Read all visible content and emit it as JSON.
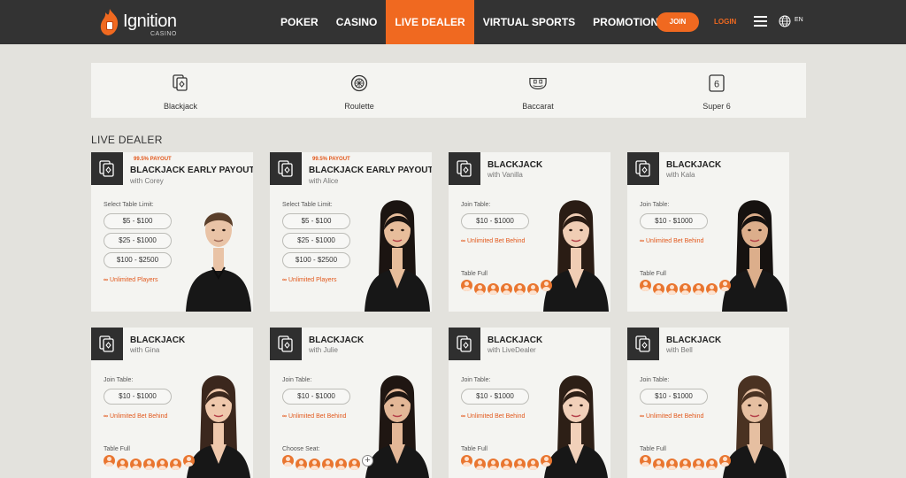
{
  "brand": {
    "name": "Ignition",
    "sub": "CASINO"
  },
  "nav": [
    {
      "label": "POKER",
      "active": false
    },
    {
      "label": "CASINO",
      "active": false
    },
    {
      "label": "LIVE DEALER",
      "active": true
    },
    {
      "label": "VIRTUAL SPORTS",
      "active": false
    },
    {
      "label": "PROMOTIONS",
      "active": false
    }
  ],
  "header": {
    "join": "JOIN",
    "login": "LOGIN",
    "lang": "EN"
  },
  "categories": [
    {
      "label": "Blackjack",
      "icon": "cards-icon"
    },
    {
      "label": "Roulette",
      "icon": "roulette-wheel-icon"
    },
    {
      "label": "Baccarat",
      "icon": "baccarat-table-icon"
    },
    {
      "label": "Super 6",
      "icon": "super-six-icon"
    }
  ],
  "section_title": "LIVE DEALER",
  "cards": [
    {
      "badge": "99.5% PAYOUT",
      "title": "BLACKJACK EARLY PAYOUT",
      "dealer": "with Corey",
      "limit_label": "Select Table Limit:",
      "limits": [
        "$5 - $100",
        "$25 - $1000",
        "$100 - $2500"
      ],
      "perk": "Unlimited Players",
      "full_label": "",
      "seat_count": 0,
      "add_seat": false
    },
    {
      "badge": "99.5% PAYOUT",
      "title": "BLACKJACK EARLY PAYOUT",
      "dealer": "with Alice",
      "limit_label": "Select Table Limit:",
      "limits": [
        "$5 - $100",
        "$25 - $1000",
        "$100 - $2500"
      ],
      "perk": "Unlimited Players",
      "full_label": "",
      "seat_count": 0,
      "add_seat": false
    },
    {
      "badge": "",
      "title": "BLACKJACK",
      "dealer": "with Vanilla",
      "limit_label": "Join Table:",
      "limits": [
        "$10 - $1000"
      ],
      "perk": "Unlimited Bet Behind",
      "full_label": "Table Full",
      "seat_count": 7,
      "add_seat": false
    },
    {
      "badge": "",
      "title": "BLACKJACK",
      "dealer": "with Kala",
      "limit_label": "Join Table:",
      "limits": [
        "$10 - $1000"
      ],
      "perk": "Unlimited Bet Behind",
      "full_label": "Table Full",
      "seat_count": 7,
      "add_seat": false
    },
    {
      "badge": "",
      "title": "BLACKJACK",
      "dealer": "with Gina",
      "limit_label": "Join Table:",
      "limits": [
        "$10 - $1000"
      ],
      "perk": "Unlimited Bet Behind",
      "full_label": "Table Full",
      "seat_count": 7,
      "add_seat": false
    },
    {
      "badge": "",
      "title": "BLACKJACK",
      "dealer": "with Julie",
      "limit_label": "Join Table:",
      "limits": [
        "$10 - $1000"
      ],
      "perk": "Unlimited Bet Behind",
      "full_label": "Choose Seat:",
      "seat_count": 6,
      "add_seat": true
    },
    {
      "badge": "",
      "title": "BLACKJACK",
      "dealer": "with LiveDealer",
      "limit_label": "Join Table:",
      "limits": [
        "$10 - $1000"
      ],
      "perk": "Unlimited Bet Behind",
      "full_label": "Table Full",
      "seat_count": 7,
      "add_seat": false
    },
    {
      "badge": "",
      "title": "BLACKJACK",
      "dealer": "with Bell",
      "limit_label": "Join Table:",
      "limits": [
        "$10 - $1000"
      ],
      "perk": "Unlimited Bet Behind",
      "full_label": "Table Full",
      "seat_count": 7,
      "add_seat": false
    }
  ],
  "colors": {
    "accent": "#f06920",
    "header": "#333333",
    "page": "#e3e2dd",
    "card": "#f4f4f1"
  }
}
